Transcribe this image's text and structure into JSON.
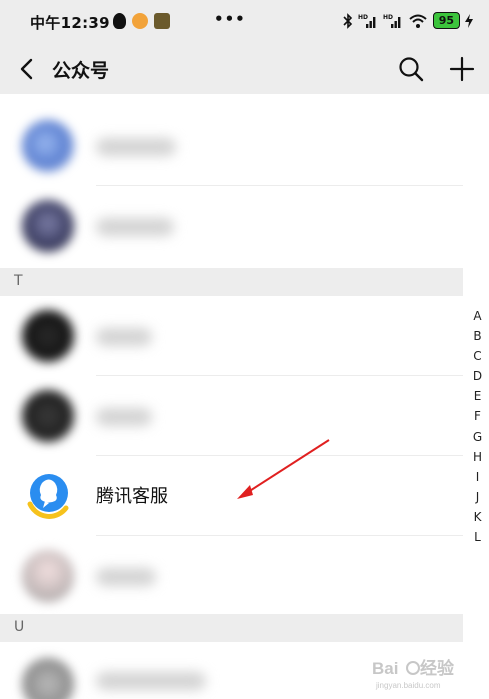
{
  "status_bar": {
    "time": "中午12:39",
    "dots": "•••",
    "battery": "95"
  },
  "nav": {
    "title": "公众号"
  },
  "sections": {
    "t_letter": "T",
    "u_letter": "U"
  },
  "highlighted_account": {
    "name": "腾讯客服"
  },
  "alpha_index": [
    "A",
    "B",
    "C",
    "D",
    "E",
    "F",
    "G",
    "H",
    "I",
    "J",
    "K",
    "L"
  ],
  "colors": {
    "background": "#ededed",
    "tencent_blue": "#2a8df0",
    "tencent_yellow": "#f6c21c",
    "arrow_red": "#e02020",
    "battery_green": "#3cc43c"
  },
  "icons": [
    "back-arrow-icon",
    "search-icon",
    "add-icon",
    "tencent-service-icon"
  ]
}
